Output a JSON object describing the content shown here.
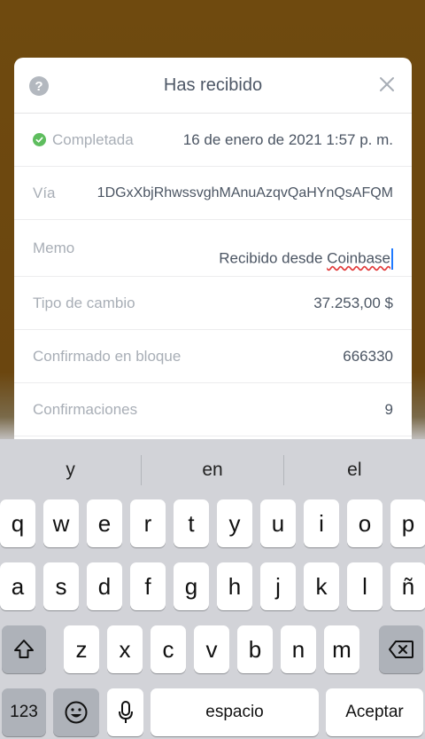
{
  "modal": {
    "title": "Has recibido",
    "help_icon": "?",
    "rows": {
      "status": {
        "label": "Completada",
        "value": "16 de enero de 2021 1:57 p. m."
      },
      "via": {
        "label": "Vía",
        "value": "1DGxXbjRhwssvghMAnuAzqvQaHYnQsAFQM"
      },
      "memo": {
        "label": "Memo",
        "value_prefix": "Recibido desde ",
        "value_misspelled": "Coinbase"
      },
      "exchange_rate": {
        "label": "Tipo de cambio",
        "value": "37.253,00 $"
      },
      "confirmed_block": {
        "label": "Confirmado en bloque",
        "value": "666330"
      },
      "confirmations": {
        "label": "Confirmaciones",
        "value": "9"
      }
    }
  },
  "keyboard": {
    "suggestions": [
      "y",
      "en",
      "el"
    ],
    "row1": [
      "q",
      "w",
      "e",
      "r",
      "t",
      "y",
      "u",
      "i",
      "o",
      "p"
    ],
    "row2": [
      "a",
      "s",
      "d",
      "f",
      "g",
      "h",
      "j",
      "k",
      "l",
      "ñ"
    ],
    "row3": [
      "z",
      "x",
      "c",
      "v",
      "b",
      "n",
      "m"
    ],
    "numbers_label": "123",
    "space_label": "espacio",
    "return_label": "Aceptar"
  },
  "colors": {
    "success": "#5ebd5e",
    "caret": "#1f7aff",
    "spellcheck": "#e23b3b"
  }
}
